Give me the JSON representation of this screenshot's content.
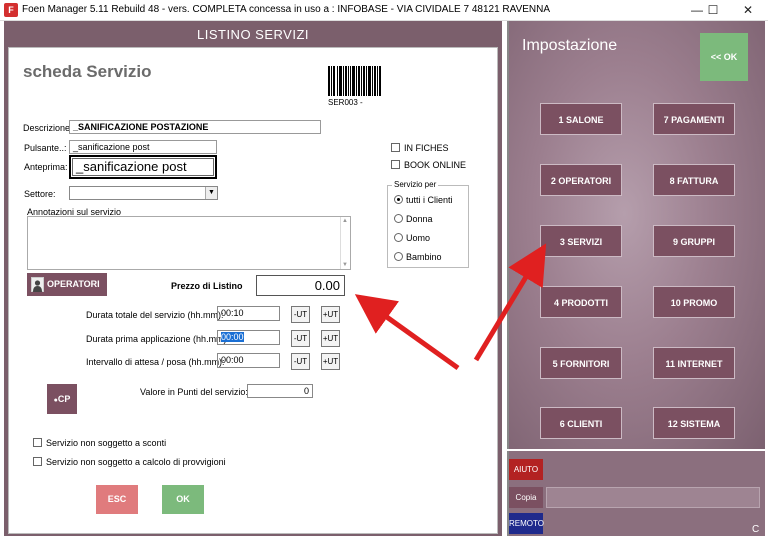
{
  "window": {
    "title": "Foen Manager 5.11 Rebuild 48 - vers. COMPLETA concessa in uso a : INFOBASE - VIA CIVIDALE 7 48121 RAVENNA",
    "app_icon": "F",
    "minimize": "—",
    "maximize": "☐",
    "close": "✕"
  },
  "left": {
    "header": "LISTINO SERVIZI",
    "form_title": "scheda Servizio",
    "barcode_code": "SER003 -",
    "descrizione_label": "Descrizione",
    "descrizione_value": "_SANIFICAZIONE POSTAZIONE",
    "pulsante_label": "Pulsante..:",
    "pulsante_value": "_sanificazione post",
    "anteprima_label": "Anteprima:",
    "anteprima_value": "_sanificazione post",
    "settore_label": "Settore:",
    "settore_value": "",
    "annotazioni_label": "Annotazioni sul servizio",
    "in_fiches_label": "IN FICHES",
    "book_online_label": "BOOK ONLINE",
    "servizio_per_label": "Servizio per",
    "servizio_per_options": [
      "tutti i Clienti",
      "Donna",
      "Uomo",
      "Bambino"
    ],
    "servizio_per_selected": 0,
    "operatori_label": "OPERATORI",
    "prezzo_label": "Prezzo di Listino",
    "prezzo_value": "0.00",
    "durata_totale_label": "Durata totale del servizio (hh.mm):",
    "durata_totale_value": "00:10",
    "durata_prima_label": "Durata prima applicazione (hh.mm):",
    "durata_prima_value": "00:00",
    "intervallo_label": "Intervallo di attesa / posa  (hh.mm):",
    "intervallo_value": "00:00",
    "minus_ut": "-UT",
    "plus_ut": "+UT",
    "cp_label": "CP",
    "punti_label": "Valore in Punti del servizio:",
    "punti_value": "0",
    "no_sconti_label": "Servizio non soggetto a sconti",
    "no_provvigioni_label": "Servizio non soggetto a calcolo di provvigioni",
    "esc_label": "ESC",
    "ok_label": "OK"
  },
  "right": {
    "title": "Impostazione",
    "ok_label": "<< OK",
    "buttons_left": [
      "1 SALONE",
      "2 OPERATORI",
      "3 SERVIZI",
      "4 PRODOTTI",
      "5 FORNITORI",
      "6 CLIENTI"
    ],
    "buttons_right": [
      "7 PAGAMENTI",
      "8 FATTURA",
      "9 GRUPPI",
      "10 PROMO",
      "11 INTERNET",
      "12 SISTEMA"
    ],
    "aiuto_label": "AIUTO",
    "copia_label": "Copia",
    "remoto_label": "REMOTO",
    "corner_label": "C"
  },
  "colors": {
    "accent": "#7b5061",
    "ok_green": "#7cba7c",
    "esc_red": "#e07b7d",
    "arrow_red": "#e02020"
  }
}
